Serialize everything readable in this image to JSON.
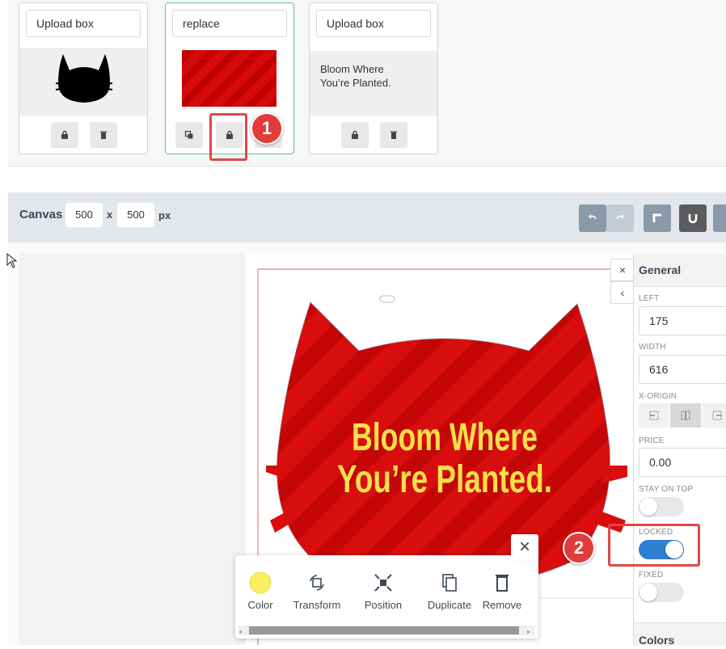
{
  "layers": [
    {
      "input_value": "Upload box",
      "type": "image"
    },
    {
      "input_value": "replace",
      "type": "pattern"
    },
    {
      "input_value": "Upload box",
      "preview_line1": "Bloom Where",
      "preview_line2": "You’re Planted."
    }
  ],
  "markers": {
    "one": "1",
    "two": "2"
  },
  "canvas": {
    "label": "Canvas",
    "width": "500",
    "times": "x",
    "height": "500",
    "unit": "px"
  },
  "design": {
    "text_line1": "Bloom Where",
    "text_line2": "You’re Planted.",
    "main_color": "#d80d0d",
    "text_color": "#f6e04a"
  },
  "panel": {
    "close_symbol": "×",
    "collapse_symbol": "‹",
    "title": "General",
    "left_label": "LEFT",
    "left_value": "175",
    "width_label": "WIDTH",
    "width_value": "616",
    "xorigin_label": "X-ORIGIN",
    "price_label": "PRICE",
    "price_value": "0.00",
    "stay_label": "STAY ON TOP",
    "locked_label": "LOCKED",
    "fixed_label": "FIXED",
    "colors_label": "Colors",
    "stay_on_top": false,
    "locked": true,
    "fixed": false
  },
  "popup": {
    "items": [
      {
        "label": "Color",
        "icon": "color-swatch-icon"
      },
      {
        "label": "Transform",
        "icon": "transform-icon"
      },
      {
        "label": "Position",
        "icon": "position-icon"
      },
      {
        "label": "Duplicate",
        "icon": "duplicate-icon"
      },
      {
        "label": "Remove",
        "icon": "trash-icon"
      }
    ],
    "close_symbol": "×",
    "swatch_color": "#f9ef63"
  },
  "toolbar": {
    "undo_color": "#8a9aa8",
    "tool_color": "#8a9aa8",
    "magnet_color": "#5c5c5c"
  }
}
